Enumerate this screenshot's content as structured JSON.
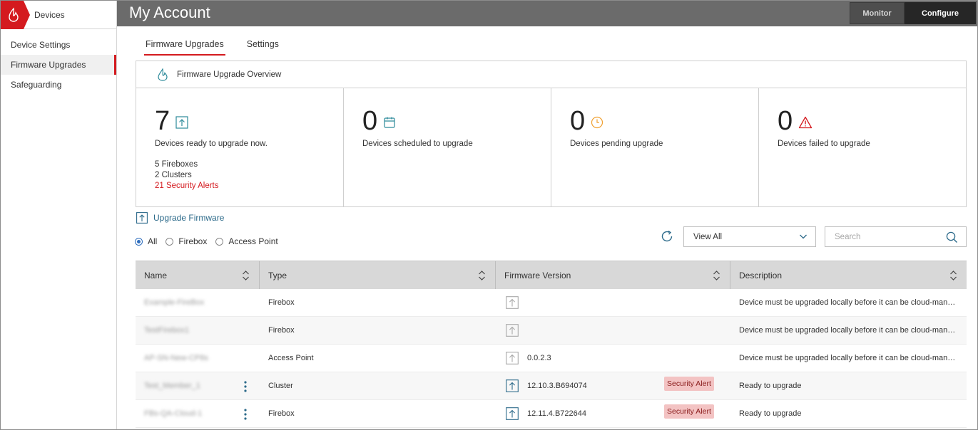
{
  "sidebar": {
    "title": "Devices",
    "items": [
      {
        "label": "Device Settings",
        "active": false
      },
      {
        "label": "Firmware Upgrades",
        "active": true
      },
      {
        "label": "Safeguarding",
        "active": false
      }
    ]
  },
  "header": {
    "title": "My Account",
    "monitor_label": "Monitor",
    "configure_label": "Configure"
  },
  "tabs": [
    {
      "label": "Firmware Upgrades",
      "active": true
    },
    {
      "label": "Settings",
      "active": false
    }
  ],
  "overview": {
    "title": "Firmware Upgrade Overview",
    "cells": [
      {
        "count": "7",
        "label": "Devices ready to upgrade now.",
        "icon": "upload-icon",
        "icon_color": "#2c8a9a"
      },
      {
        "count": "0",
        "label": "Devices scheduled to upgrade",
        "icon": "calendar-icon",
        "icon_color": "#2c8a9a"
      },
      {
        "count": "0",
        "label": "Devices pending upgrade",
        "icon": "clock-icon",
        "icon_color": "#f0a030"
      },
      {
        "count": "0",
        "label": "Devices failed to upgrade",
        "icon": "warning-icon",
        "icon_color": "#d41a1f"
      }
    ],
    "ready_details": {
      "fireboxes": "5 Fireboxes",
      "clusters": "2 Clusters",
      "alerts": "21 Security Alerts"
    }
  },
  "actions": {
    "upgrade_firmware": "Upgrade Firmware"
  },
  "filters": {
    "options": [
      "All",
      "Firebox",
      "Access Point"
    ],
    "selected": "All"
  },
  "view_select": {
    "value": "View All"
  },
  "search": {
    "placeholder": "Search"
  },
  "table": {
    "columns": [
      "Name",
      "Type",
      "Firmware Version",
      "Description"
    ],
    "rows": [
      {
        "name": "Example-FireBox",
        "type": "Firebox",
        "version": "",
        "alert": "",
        "has_menu": false,
        "upgrade_enabled": false,
        "description": "Device must be upgraded locally before it can be cloud-man…"
      },
      {
        "name": "TestFirebox1",
        "type": "Firebox",
        "version": "",
        "alert": "",
        "has_menu": false,
        "upgrade_enabled": false,
        "description": "Device must be upgraded locally before it can be cloud-man…"
      },
      {
        "name": "AP-SN-New-CP8s",
        "type": "Access Point",
        "version": "0.0.2.3",
        "alert": "",
        "has_menu": false,
        "upgrade_enabled": false,
        "description": "Device must be upgraded locally before it can be cloud-man…"
      },
      {
        "name": "Test_Member_1",
        "type": "Cluster",
        "version": "12.10.3.B694074",
        "alert": "Security Alert",
        "has_menu": true,
        "upgrade_enabled": true,
        "description": "Ready to upgrade"
      },
      {
        "name": "FBs-QA-Cloud-1",
        "type": "Firebox",
        "version": "12.11.4.B722644",
        "alert": "Security Alert",
        "has_menu": true,
        "upgrade_enabled": true,
        "description": "Ready to upgrade"
      }
    ]
  },
  "colors": {
    "brand_red": "#d41a1f",
    "header_bg": "#6b6b6b",
    "link": "#2c6a8a",
    "alert_badge_bg": "#f3c3c3"
  }
}
